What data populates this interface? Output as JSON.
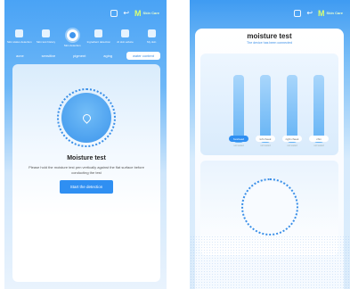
{
  "left": {
    "nav": [
      {
        "label": "Skin status detection",
        "icon": "camera-icon",
        "active": false
      },
      {
        "label": "Skin test history",
        "icon": "clipboard-icon",
        "active": false
      },
      {
        "label": "Skin detection",
        "icon": "water-icon",
        "active": true
      },
      {
        "label": "Ingredient detection",
        "icon": "flask-icon",
        "active": false
      },
      {
        "label": "AI skin advice",
        "icon": "shield-icon",
        "active": false
      },
      {
        "label": "My skin",
        "icon": "user-icon",
        "active": false
      }
    ],
    "tabs": [
      {
        "label": "acne",
        "active": false
      },
      {
        "label": "sensitive",
        "active": false
      },
      {
        "label": "pigment",
        "active": false
      },
      {
        "label": "aging",
        "active": false
      },
      {
        "label": "water content",
        "active": true
      }
    ],
    "title": "Moisture test",
    "description": "Please hold the moisture test pen vertically against the flat surface before conducting the test",
    "start_button": "Start the detection"
  },
  "right": {
    "title": "moisture test",
    "subtitle": "The device has been connected",
    "zones": [
      {
        "label": "forehead",
        "value": "not tested",
        "active": true
      },
      {
        "label": "left cheek",
        "value": "not tested",
        "active": false
      },
      {
        "label": "right cheek",
        "value": "not tested",
        "active": false
      },
      {
        "label": "chin",
        "value": "not tested",
        "active": false
      }
    ]
  },
  "brand": {
    "logo_text": "M",
    "logo_sub": "Skin Care"
  },
  "colors": {
    "primary": "#2f8ff2",
    "accent": "#d9ff73"
  }
}
